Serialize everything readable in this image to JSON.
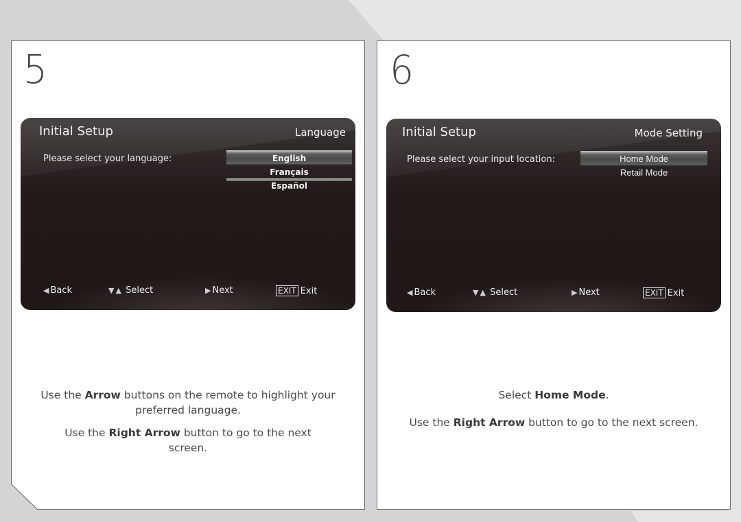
{
  "steps": [
    {
      "number": "5",
      "screen": {
        "title": "Initial Setup",
        "section": "Language",
        "prompt": "Please select your language:",
        "options": [
          "English",
          "Français",
          "Español"
        ],
        "selected_option": "English",
        "footer": {
          "back": "Back",
          "select": "Select",
          "next": "Next",
          "exit_key": "EXIT",
          "exit": "Exit"
        }
      },
      "instructions": [
        {
          "pre": "Use the ",
          "bold": "Arrow",
          "post": " buttons on the remote to highlight your preferred language."
        },
        {
          "pre": "Use the ",
          "bold": "Right Arrow",
          "post": " button to go to the next screen."
        }
      ]
    },
    {
      "number": "6",
      "screen": {
        "title": "Initial Setup",
        "section": "Mode Setting",
        "prompt": "Please select your input location:",
        "options": [
          "Home Mode",
          "Retail Mode"
        ],
        "selected_option": "Home Mode",
        "footer": {
          "back": "Back",
          "select": "Select",
          "next": "Next",
          "exit_key": "EXIT",
          "exit": "Exit"
        }
      },
      "instructions": [
        {
          "pre": "Select ",
          "bold": "Home Mode",
          "post": "."
        },
        {
          "pre": "Use the ",
          "bold": "Right Arrow",
          "post": " button to go to the next screen."
        }
      ]
    }
  ],
  "icons": {
    "back": "◀",
    "select_down": "▼",
    "select_up": "▲",
    "next": "▶"
  }
}
